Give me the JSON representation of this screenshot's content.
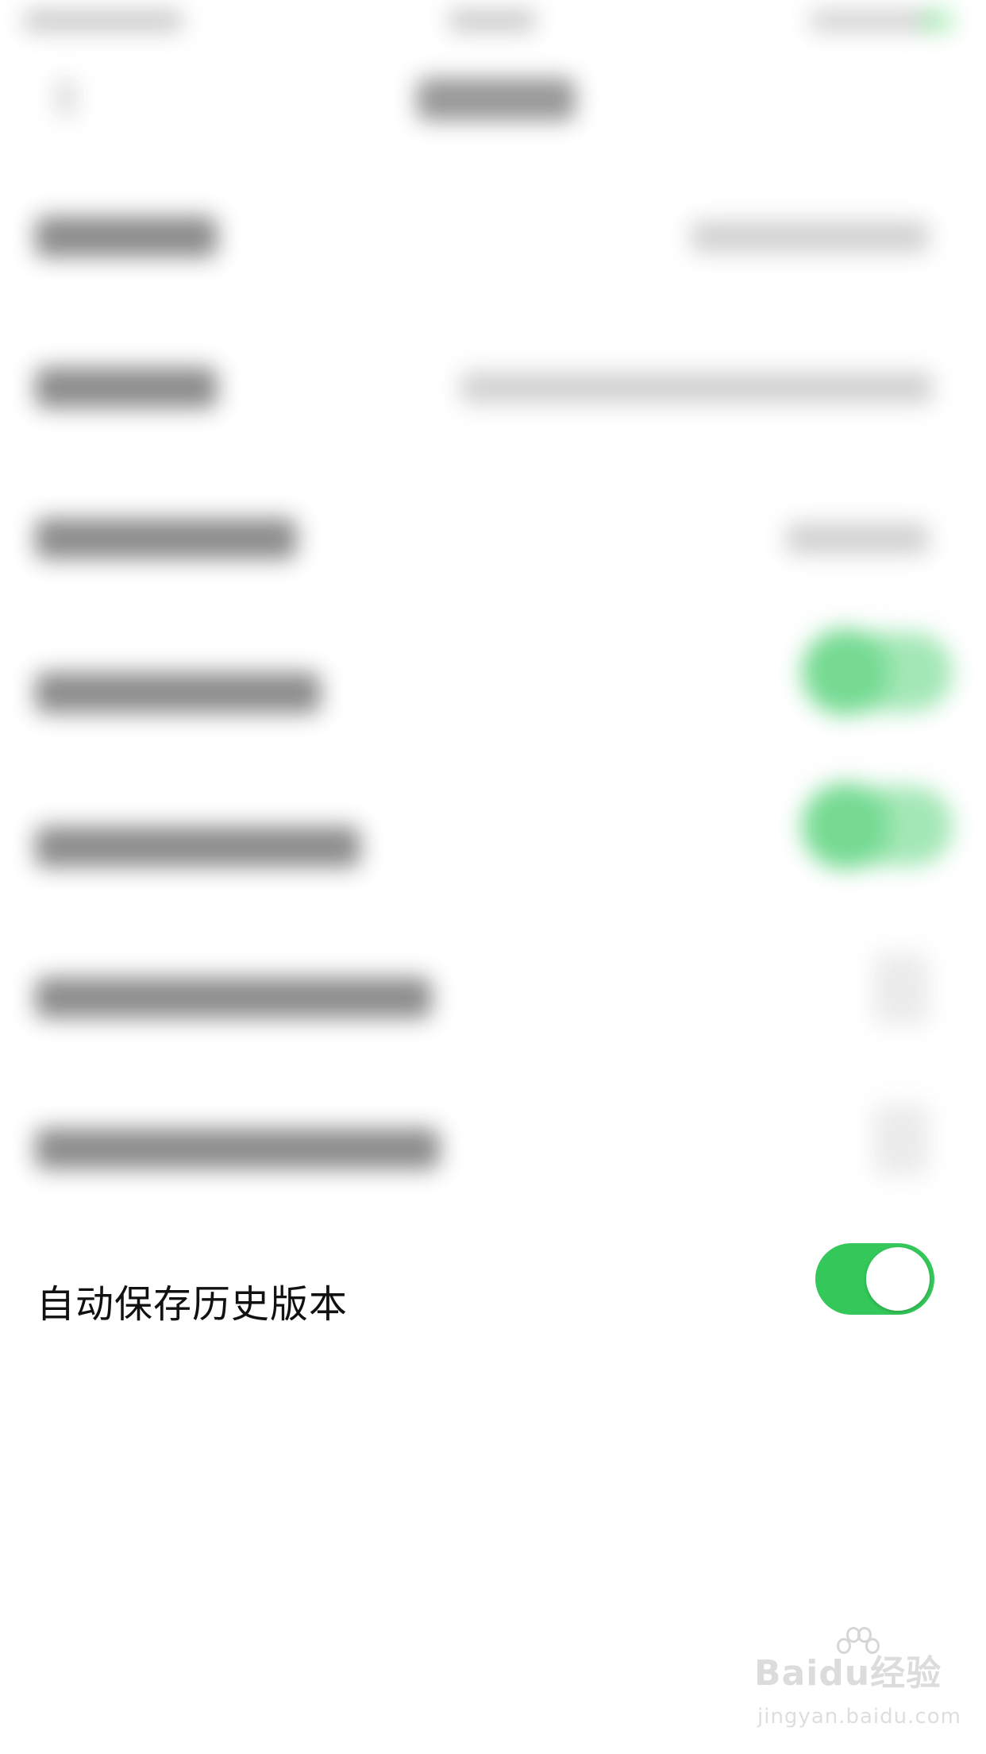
{
  "settings": {
    "rows": [
      {
        "label": "自动保存历史版本",
        "toggle_on": true
      }
    ]
  },
  "watermark": {
    "logo": "Baidu经验",
    "url": "jingyan.baidu.com"
  },
  "colors": {
    "toggle_on": "#34c759",
    "background": "#ffffff"
  }
}
